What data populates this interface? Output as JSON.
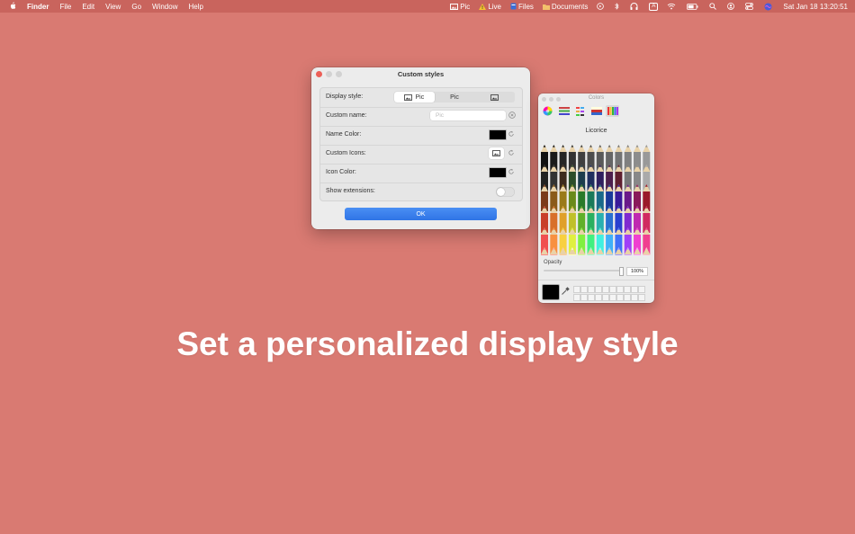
{
  "menubar": {
    "app": "Finder",
    "menus": [
      "File",
      "Edit",
      "View",
      "Go",
      "Window",
      "Help"
    ],
    "status": {
      "pic": "Pic",
      "live": "Live",
      "files": "Files",
      "documents": "Documents",
      "input_source": "A",
      "datetime": "Sat Jan 18  13:20:51"
    }
  },
  "custom_styles": {
    "title": "Custom styles",
    "rows": {
      "display_style": {
        "label": "Display style:",
        "options": [
          "Pic",
          "Pic"
        ],
        "selected": "Pic"
      },
      "custom_name": {
        "label": "Custom name:",
        "placeholder": "Pic"
      },
      "name_color": {
        "label": "Name Color:",
        "color": "#000000"
      },
      "custom_icons": {
        "label": "Custom Icons:"
      },
      "icon_color": {
        "label": "Icon Color:",
        "color": "#000000"
      },
      "show_extensions": {
        "label": "Show extensions:",
        "value": false
      }
    },
    "ok_label": "OK"
  },
  "colors_panel": {
    "title": "Colors",
    "selected_name": "Licorice",
    "opacity_label": "Opacity",
    "opacity_value": "100%",
    "current_color": "#000000"
  },
  "headline": "Set a personalized display style"
}
